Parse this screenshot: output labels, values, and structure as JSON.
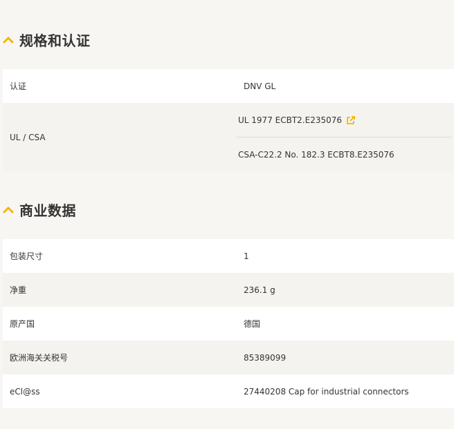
{
  "sections": [
    {
      "title": "规格和认证",
      "rows": [
        {
          "label": "认证",
          "values": [
            "DNV GL"
          ]
        },
        {
          "label": "UL / CSA",
          "values": [
            "UL 1977 ECBT2.E235076",
            "CSA-C22.2 No. 182.3 ECBT8.E235076"
          ]
        }
      ]
    },
    {
      "title": "商业数据",
      "rows": [
        {
          "label": "包装尺寸",
          "values": [
            "1"
          ]
        },
        {
          "label": "净重",
          "values": [
            "236.1 g"
          ]
        },
        {
          "label": "原产国",
          "values": [
            "德国"
          ]
        },
        {
          "label": "欧洲海关关税号",
          "values": [
            "85389099"
          ]
        },
        {
          "label": "eCl@ss",
          "values": [
            "27440208 Cap for industrial connectors"
          ]
        }
      ]
    }
  ],
  "colors": {
    "accent": "#f2b700",
    "row_white": "#ffffff",
    "row_grey": "#f4f3ef",
    "page_bg": "#f7f6f3"
  },
  "icons": {
    "section_toggle": "chevron-up-icon",
    "external_link": "external-link-icon"
  }
}
